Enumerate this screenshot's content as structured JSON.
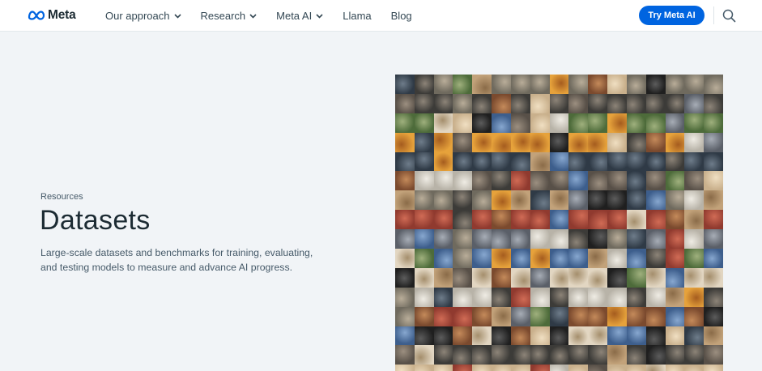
{
  "header": {
    "brand": "Meta",
    "nav": [
      {
        "label": "Our approach",
        "has_dropdown": true
      },
      {
        "label": "Research",
        "has_dropdown": true
      },
      {
        "label": "Meta AI",
        "has_dropdown": true
      },
      {
        "label": "Llama",
        "has_dropdown": false
      },
      {
        "label": "Blog",
        "has_dropdown": false
      }
    ],
    "cta_label": "Try Meta AI",
    "search_icon": "search-icon"
  },
  "hero": {
    "eyebrow": "Resources",
    "title": "Datasets",
    "description_line1": "Large-scale datasets and benchmarks for training, evaluating,",
    "description_line2": "and testing models to measure and advance AI progress."
  },
  "colors": {
    "accent": "#0064e0",
    "page_bg": "#f1f4f7",
    "header_bg": "#ffffff",
    "text": "#1c2b33"
  }
}
